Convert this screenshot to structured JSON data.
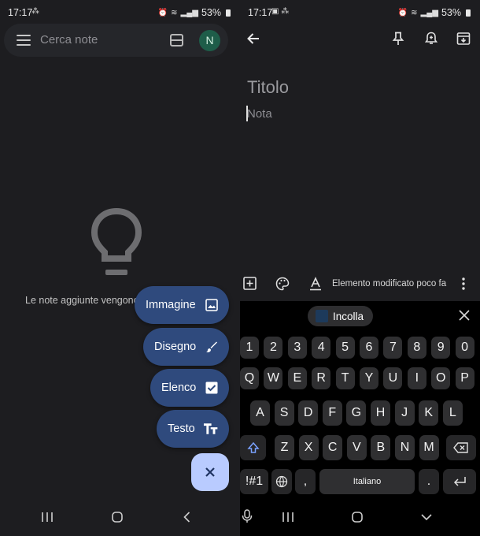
{
  "left": {
    "status": {
      "time": "17:17",
      "battery": "53%"
    },
    "search": {
      "placeholder": "Cerca note",
      "avatar_letter": "N"
    },
    "empty_message": "Le note aggiunte vengono",
    "fab_menu": [
      {
        "label": "Immagine",
        "icon": "image-icon"
      },
      {
        "label": "Disegno",
        "icon": "brush-icon"
      },
      {
        "label": "Elenco",
        "icon": "checkbox-icon"
      },
      {
        "label": "Testo",
        "icon": "text-icon"
      }
    ],
    "fab_close_icon": "close-icon"
  },
  "right": {
    "status": {
      "time": "17:17",
      "battery": "53%"
    },
    "title_placeholder": "Titolo",
    "note_placeholder": "Nota",
    "toolbar_status": "Elemento modificato poco fa",
    "keyboard": {
      "paste_label": "Incolla",
      "row_numbers": [
        "1",
        "2",
        "3",
        "4",
        "5",
        "6",
        "7",
        "8",
        "9",
        "0"
      ],
      "row1": [
        "Q",
        "W",
        "E",
        "R",
        "T",
        "Y",
        "U",
        "I",
        "O",
        "P"
      ],
      "row2": [
        "A",
        "S",
        "D",
        "F",
        "G",
        "H",
        "J",
        "K",
        "L"
      ],
      "row3": [
        "Z",
        "X",
        "C",
        "V",
        "B",
        "N",
        "M"
      ],
      "symbols_label": "!#1",
      "comma": ",",
      "space_label": "Italiano",
      "period": "."
    }
  },
  "colors": {
    "fab": "#2f4a7d",
    "fab_close": "#b9cbff",
    "avatar": "#1e5d49",
    "background": "#1d1d20"
  }
}
